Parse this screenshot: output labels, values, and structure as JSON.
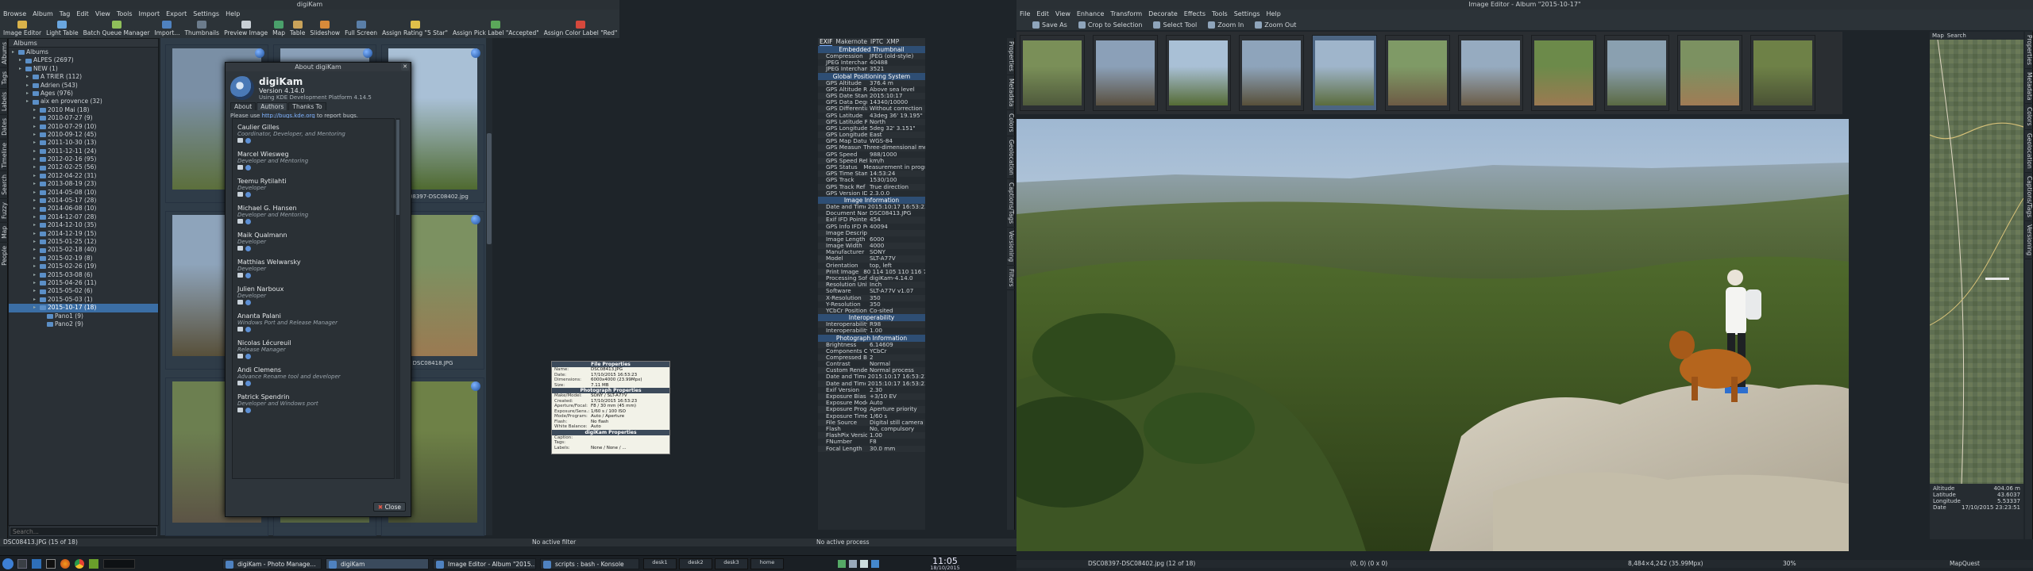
{
  "digikam": {
    "title": "digiKam",
    "menu": [
      "Browse",
      "Album",
      "Tag",
      "Edit",
      "View",
      "Tools",
      "Import",
      "Export",
      "Settings",
      "Help"
    ],
    "toolbar": [
      "Image Editor",
      "Light Table",
      "Batch Queue Manager",
      "Import...",
      "Thumbnails",
      "Preview Image",
      "Map",
      "Table",
      "Slideshow",
      "Full Screen",
      "Assign Rating \"5 Star\"",
      "Assign Pick Label \"Accepted\"",
      "Assign Color Label \"Red\""
    ],
    "left_tabs": [
      "Albums",
      "Tags",
      "Labels",
      "Dates",
      "Timeline",
      "Search",
      "Fuzzy",
      "Map",
      "People"
    ],
    "tree_header": "Albums",
    "tree": [
      {
        "label": "Albums",
        "depth": 0
      },
      {
        "label": "ALPES (2697)",
        "depth": 1
      },
      {
        "label": "NEW (1)",
        "depth": 1
      },
      {
        "label": "A TRIER (112)",
        "depth": 2
      },
      {
        "label": "Adrien (543)",
        "depth": 2
      },
      {
        "label": "Ages (976)",
        "depth": 2
      },
      {
        "label": "aix en provence (32)",
        "depth": 2
      },
      {
        "label": "2010 Mai (18)",
        "depth": 3
      },
      {
        "label": "2010-07-27 (9)",
        "depth": 3
      },
      {
        "label": "2010-07-29 (10)",
        "depth": 3
      },
      {
        "label": "2010-09-12 (45)",
        "depth": 3
      },
      {
        "label": "2011-10-30 (13)",
        "depth": 3
      },
      {
        "label": "2011-12-11 (24)",
        "depth": 3
      },
      {
        "label": "2012-02-16 (95)",
        "depth": 3
      },
      {
        "label": "2012-02-25 (56)",
        "depth": 3
      },
      {
        "label": "2012-04-22 (31)",
        "depth": 3
      },
      {
        "label": "2013-08-19 (23)",
        "depth": 3
      },
      {
        "label": "2014-05-08 (10)",
        "depth": 3
      },
      {
        "label": "2014-05-17 (28)",
        "depth": 3
      },
      {
        "label": "2014-06-08 (10)",
        "depth": 3
      },
      {
        "label": "2014-12-07 (28)",
        "depth": 3
      },
      {
        "label": "2014-12-10 (35)",
        "depth": 3
      },
      {
        "label": "2014-12-19 (15)",
        "depth": 3
      },
      {
        "label": "2015-01-25 (12)",
        "depth": 3
      },
      {
        "label": "2015-02-18 (40)",
        "depth": 3
      },
      {
        "label": "2015-02-19 (8)",
        "depth": 3
      },
      {
        "label": "2015-02-26 (19)",
        "depth": 3
      },
      {
        "label": "2015-03-08 (6)",
        "depth": 3
      },
      {
        "label": "2015-04-26 (11)",
        "depth": 3
      },
      {
        "label": "2015-05-02 (6)",
        "depth": 3
      },
      {
        "label": "2015-05-03 (1)",
        "depth": 3
      },
      {
        "label": "2015-10-17 (18)",
        "depth": 3,
        "selected": true
      },
      {
        "label": "Pano1 (9)",
        "depth": 4
      },
      {
        "label": "Pano2 (9)",
        "depth": 4
      }
    ],
    "search_placeholder": "Search...",
    "thumbs": [
      {
        "cap": "",
        "colors": [
          "#7a8fa5",
          "#5c6f3c"
        ]
      },
      {
        "cap": "DSC08394.JPG",
        "colors": [
          "#8aa0b8",
          "#6b5a3d"
        ]
      },
      {
        "cap": "DSC08397-DSC08402.jpg",
        "colors": [
          "#a9c0d6",
          "#4f6a30"
        ]
      },
      {
        "cap": "",
        "colors": [
          "#8ea4bb",
          "#58503a"
        ]
      },
      {
        "cap": "DSC08413.JPG",
        "colors": [
          "#7f9a66",
          "#6d5b45"
        ]
      },
      {
        "cap": "DSC08418.JPG",
        "colors": [
          "#7c9161",
          "#9b7a52"
        ]
      },
      {
        "cap": "",
        "colors": [
          "#6c7f50",
          "#5c5445"
        ]
      },
      {
        "cap": "",
        "colors": [
          "#8aa0b0",
          "#5b6a43"
        ]
      },
      {
        "cap": "",
        "colors": [
          "#6e8147",
          "#4a5235"
        ]
      }
    ],
    "partial_caption": "386.jpg",
    "status_left": "DSC08413.JPG (15 of 18)",
    "status_filter": "No active filter",
    "status_process": "No active process",
    "tooltip": {
      "file_head": "File Properties",
      "file_rows": [
        [
          "Name:",
          "DSC08413.JPG"
        ],
        [
          "Date:",
          "17/10/2015 16:53:23"
        ],
        [
          "Dimensions:",
          "6000x4000 (23.99Mpx)"
        ],
        [
          "Size:",
          "7.11 MB"
        ]
      ],
      "photo_head": "Photograph Properties",
      "photo_rows": [
        [
          "Make/Model:",
          "SONY / SLT-A77V"
        ],
        [
          "Created:",
          "17/10/2015 16:53:23"
        ],
        [
          "Aperture/Focal:",
          "F8 / 30 mm (45 mm)"
        ],
        [
          "Exposure/Sens.:",
          "1/60 s / 100 ISO"
        ],
        [
          "Mode/Program:",
          "Auto / Aperture"
        ],
        [
          "Flash:",
          "No flash"
        ],
        [
          "White Balance:",
          "Auto"
        ]
      ],
      "dk_head": "digiKam Properties",
      "dk_rows": [
        [
          "Caption:",
          ""
        ],
        [
          "Tags:",
          ""
        ],
        [
          "Labels:",
          "None / None / ..."
        ]
      ]
    }
  },
  "about": {
    "title": "About digiKam",
    "app": "digiKam",
    "version": "Version 4.14.0",
    "using": "Using KDE Development Platform 4.14.5",
    "tabs": [
      "About",
      "Authors",
      "Thanks To"
    ],
    "report": "Please use",
    "report_link": "http://bugs.kde.org",
    "report_tail": "to report bugs.",
    "credits": [
      {
        "name": "Caulier Gilles",
        "role": "Coordinator, Developer, and Mentoring"
      },
      {
        "name": "Marcel Wiesweg",
        "role": "Developer and Mentoring"
      },
      {
        "name": "Teemu Rytilahti",
        "role": "Developer"
      },
      {
        "name": "Michael G. Hansen",
        "role": "Developer and Mentoring"
      },
      {
        "name": "Maik Qualmann",
        "role": "Developer"
      },
      {
        "name": "Matthias Welwarsky",
        "role": "Developer"
      },
      {
        "name": "Julien Narboux",
        "role": "Developer"
      },
      {
        "name": "Ananta Palani",
        "role": "Windows Port and Release Manager"
      },
      {
        "name": "Nicolas Lécureuil",
        "role": "Release Manager"
      },
      {
        "name": "Andi Clemens",
        "role": "Advance Rename tool and developer"
      },
      {
        "name": "Patrick Spendrin",
        "role": "Developer and Windows port"
      }
    ],
    "close": "Close"
  },
  "metadata": {
    "tabs": [
      "EXIF",
      "Makernote",
      "IPTC",
      "XMP"
    ],
    "right_tabs": [
      "Properties",
      "Metadata",
      "Colors",
      "Geolocation",
      "Captions/Tags",
      "Versioning",
      "Filters"
    ],
    "sections": [
      {
        "head": "Embedded Thumbnail",
        "rows": [
          [
            "Compression",
            "JPEG (old-style)"
          ],
          [
            "JPEG Interchange For...",
            "40488"
          ],
          [
            "JPEG Interchange For...",
            "3521"
          ]
        ]
      },
      {
        "head": "Global Positioning System",
        "rows": [
          [
            "GPS Altitude",
            "376.4 m"
          ],
          [
            "GPS Altitude Reference",
            "Above sea level"
          ],
          [
            "GPS Date Stamp",
            "2015:10:17"
          ],
          [
            "GPS Data Degree of P...",
            "14340/10000"
          ],
          [
            "GPS Differential",
            "Without correction"
          ],
          [
            "GPS Latitude",
            "43deg 36' 19.195\""
          ],
          [
            "GPS Latitude Reference",
            "North"
          ],
          [
            "GPS Longitude",
            "5deg 32' 3.151\""
          ],
          [
            "GPS Longitude Refere...",
            "East"
          ],
          [
            "GPS Map Datum",
            "WGS-84"
          ],
          [
            "GPS Measure Mode",
            "Three-dimensional mea..."
          ],
          [
            "GPS Speed",
            "988/1000"
          ],
          [
            "GPS Speed Reference",
            "km/h"
          ],
          [
            "GPS Status",
            "Measurement in progress"
          ],
          [
            "GPS Time Stamp",
            "14:53:24"
          ],
          [
            "GPS Track",
            "1530/100"
          ],
          [
            "GPS Track Ref",
            "True direction"
          ],
          [
            "GPS Version ID",
            "2.3.0.0"
          ]
        ]
      },
      {
        "head": "Image Information",
        "rows": [
          [
            "Date and Time",
            "2015:10:17 16:53:23"
          ],
          [
            "Document Name",
            "DSC08413.JPG"
          ],
          [
            "Exif IFD Pointer",
            "454"
          ],
          [
            "GPS Info IFD Pointer",
            "40094"
          ],
          [
            "Image Description",
            ""
          ],
          [
            "Image Length",
            "6000"
          ],
          [
            "Image Width",
            "4000"
          ],
          [
            "Manufacturer",
            "SONY"
          ],
          [
            "Model",
            "SLT-A77V"
          ],
          [
            "Orientation",
            "top, left"
          ],
          [
            "Print Image Matching",
            "80 114 105 110 116 73..."
          ],
          [
            "Processing Software",
            "digiKam-4.14.0"
          ],
          [
            "Resolution Unit",
            "Inch"
          ],
          [
            "Software",
            "SLT-A77V v1.07"
          ],
          [
            "X-Resolution",
            "350"
          ],
          [
            "Y-Resolution",
            "350"
          ],
          [
            "YCbCr Positioning",
            "Co-sited"
          ]
        ]
      },
      {
        "head": "Interoperability",
        "rows": [
          [
            "Interoperability Index",
            "R98"
          ],
          [
            "Interoperability Version",
            "1.00"
          ]
        ]
      },
      {
        "head": "Photograph Information",
        "rows": [
          [
            "Brightness",
            "6.14609"
          ],
          [
            "Components Configur...",
            "YCbCr"
          ],
          [
            "Compressed Bits per ...",
            "2"
          ],
          [
            "Contrast",
            "Normal"
          ],
          [
            "Custom Rendered",
            "Normal process"
          ],
          [
            "Date and Time (digitiz...",
            "2015:10:17 16:53:23"
          ],
          [
            "Date and Time (original)",
            "2015:10:17 16:53:23"
          ],
          [
            "Exif Version",
            "2.30"
          ],
          [
            "Exposure Bias",
            "+3/10 EV"
          ],
          [
            "Exposure Mode",
            "Auto"
          ],
          [
            "Exposure Program",
            "Aperture priority"
          ],
          [
            "Exposure Time",
            "1/60 s"
          ],
          [
            "File Source",
            "Digital still camera"
          ],
          [
            "Flash",
            "No, compulsory"
          ],
          [
            "FlashPix Version",
            "1.00"
          ],
          [
            "FNumber",
            "F8"
          ],
          [
            "Focal Length",
            "30.0 mm"
          ]
        ]
      }
    ]
  },
  "editor": {
    "title": "Image Editor - Album \"2015-10-17\"",
    "menu": [
      "File",
      "Edit",
      "View",
      "Enhance",
      "Transform",
      "Decorate",
      "Effects",
      "Tools",
      "Settings",
      "Help"
    ],
    "toolbar": [
      "Save As",
      "Crop to Selection",
      "Select Tool",
      "Zoom In",
      "Zoom Out"
    ],
    "film_colors": [
      [
        "#7a8f58",
        "#4f5a3c"
      ],
      [
        "#8ba0b8",
        "#5a5040"
      ],
      [
        "#a9c0d6",
        "#556b35"
      ],
      [
        "#8ea4bb",
        "#58503a"
      ],
      [
        "#9fb5cb",
        "#5b6c3d"
      ],
      [
        "#7f9a66",
        "#6d5b45"
      ],
      [
        "#96abc0",
        "#6b5d48"
      ],
      [
        "#6c8a4a",
        "#9b7a52"
      ],
      [
        "#8aa0b0",
        "#5b6a43"
      ],
      [
        "#7c9161",
        "#a07c55"
      ],
      [
        "#6e8147",
        "#4a5235"
      ]
    ],
    "status_file": "DSC08397-DSC08402.jpg (12 of 18)",
    "status_coords": "(0, 0) (0 x 0)",
    "status_size": "8,484×4,242 (35.99Mpx)",
    "zoom": "30%",
    "right_tabs": [
      "Properties",
      "Metadata",
      "Colors",
      "Geolocation",
      "Captions/Tags",
      "Versioning"
    ]
  },
  "map": {
    "tabs": [
      "Map",
      "Search"
    ],
    "provider": "MapQuest",
    "coords": [
      [
        "Altitude",
        "404.06 m"
      ],
      [
        "Latitude",
        "43.6037"
      ],
      [
        "Longitude",
        "5.53337"
      ],
      [
        "Date",
        "17/10/2015 23:23:51"
      ]
    ]
  },
  "taskbar": {
    "tasks": [
      "digiKam - Photo Manage...",
      "digiKam",
      "Image Editor - Album \"2015...",
      "scripts : bash - Konsole"
    ],
    "desktops": [
      "desk1",
      "desk2",
      "desk3",
      "home"
    ],
    "time": "11:05",
    "date": "18/10/2015"
  }
}
